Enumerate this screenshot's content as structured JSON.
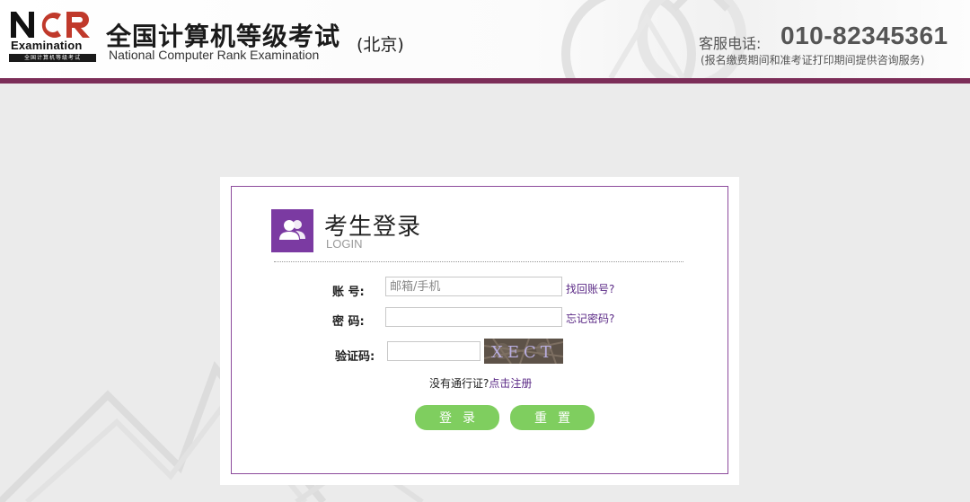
{
  "header": {
    "logo_word": "Examination",
    "logo_strip": "全国计算机等级考试",
    "title": "全国计算机等级考试",
    "subtitle": "National Computer Rank Examination",
    "region": "(北京)",
    "hotline_label": "客服电话:",
    "hotline_number": "010-82345361",
    "hotline_note": "(报名缴费期间和准考证打印期间提供咨询服务)"
  },
  "login": {
    "title": "考生登录",
    "subtitle": "LOGIN",
    "account_label": "账  号:",
    "account_placeholder": "邮箱/手机",
    "find_account": "找回账号?",
    "password_label": "密  码:",
    "forgot_password": "忘记密码?",
    "captcha_label": "验证码:",
    "captcha_text": "XECT",
    "no_pass_text": "没有通行证?",
    "register_link": "点击注册",
    "login_button": "登录",
    "reset_button": "重置"
  },
  "colors": {
    "brand_purple": "#7b3aa2",
    "header_bar": "#7c2d58",
    "button_green": "#7fce5f",
    "link_purple": "#5b2a86"
  }
}
